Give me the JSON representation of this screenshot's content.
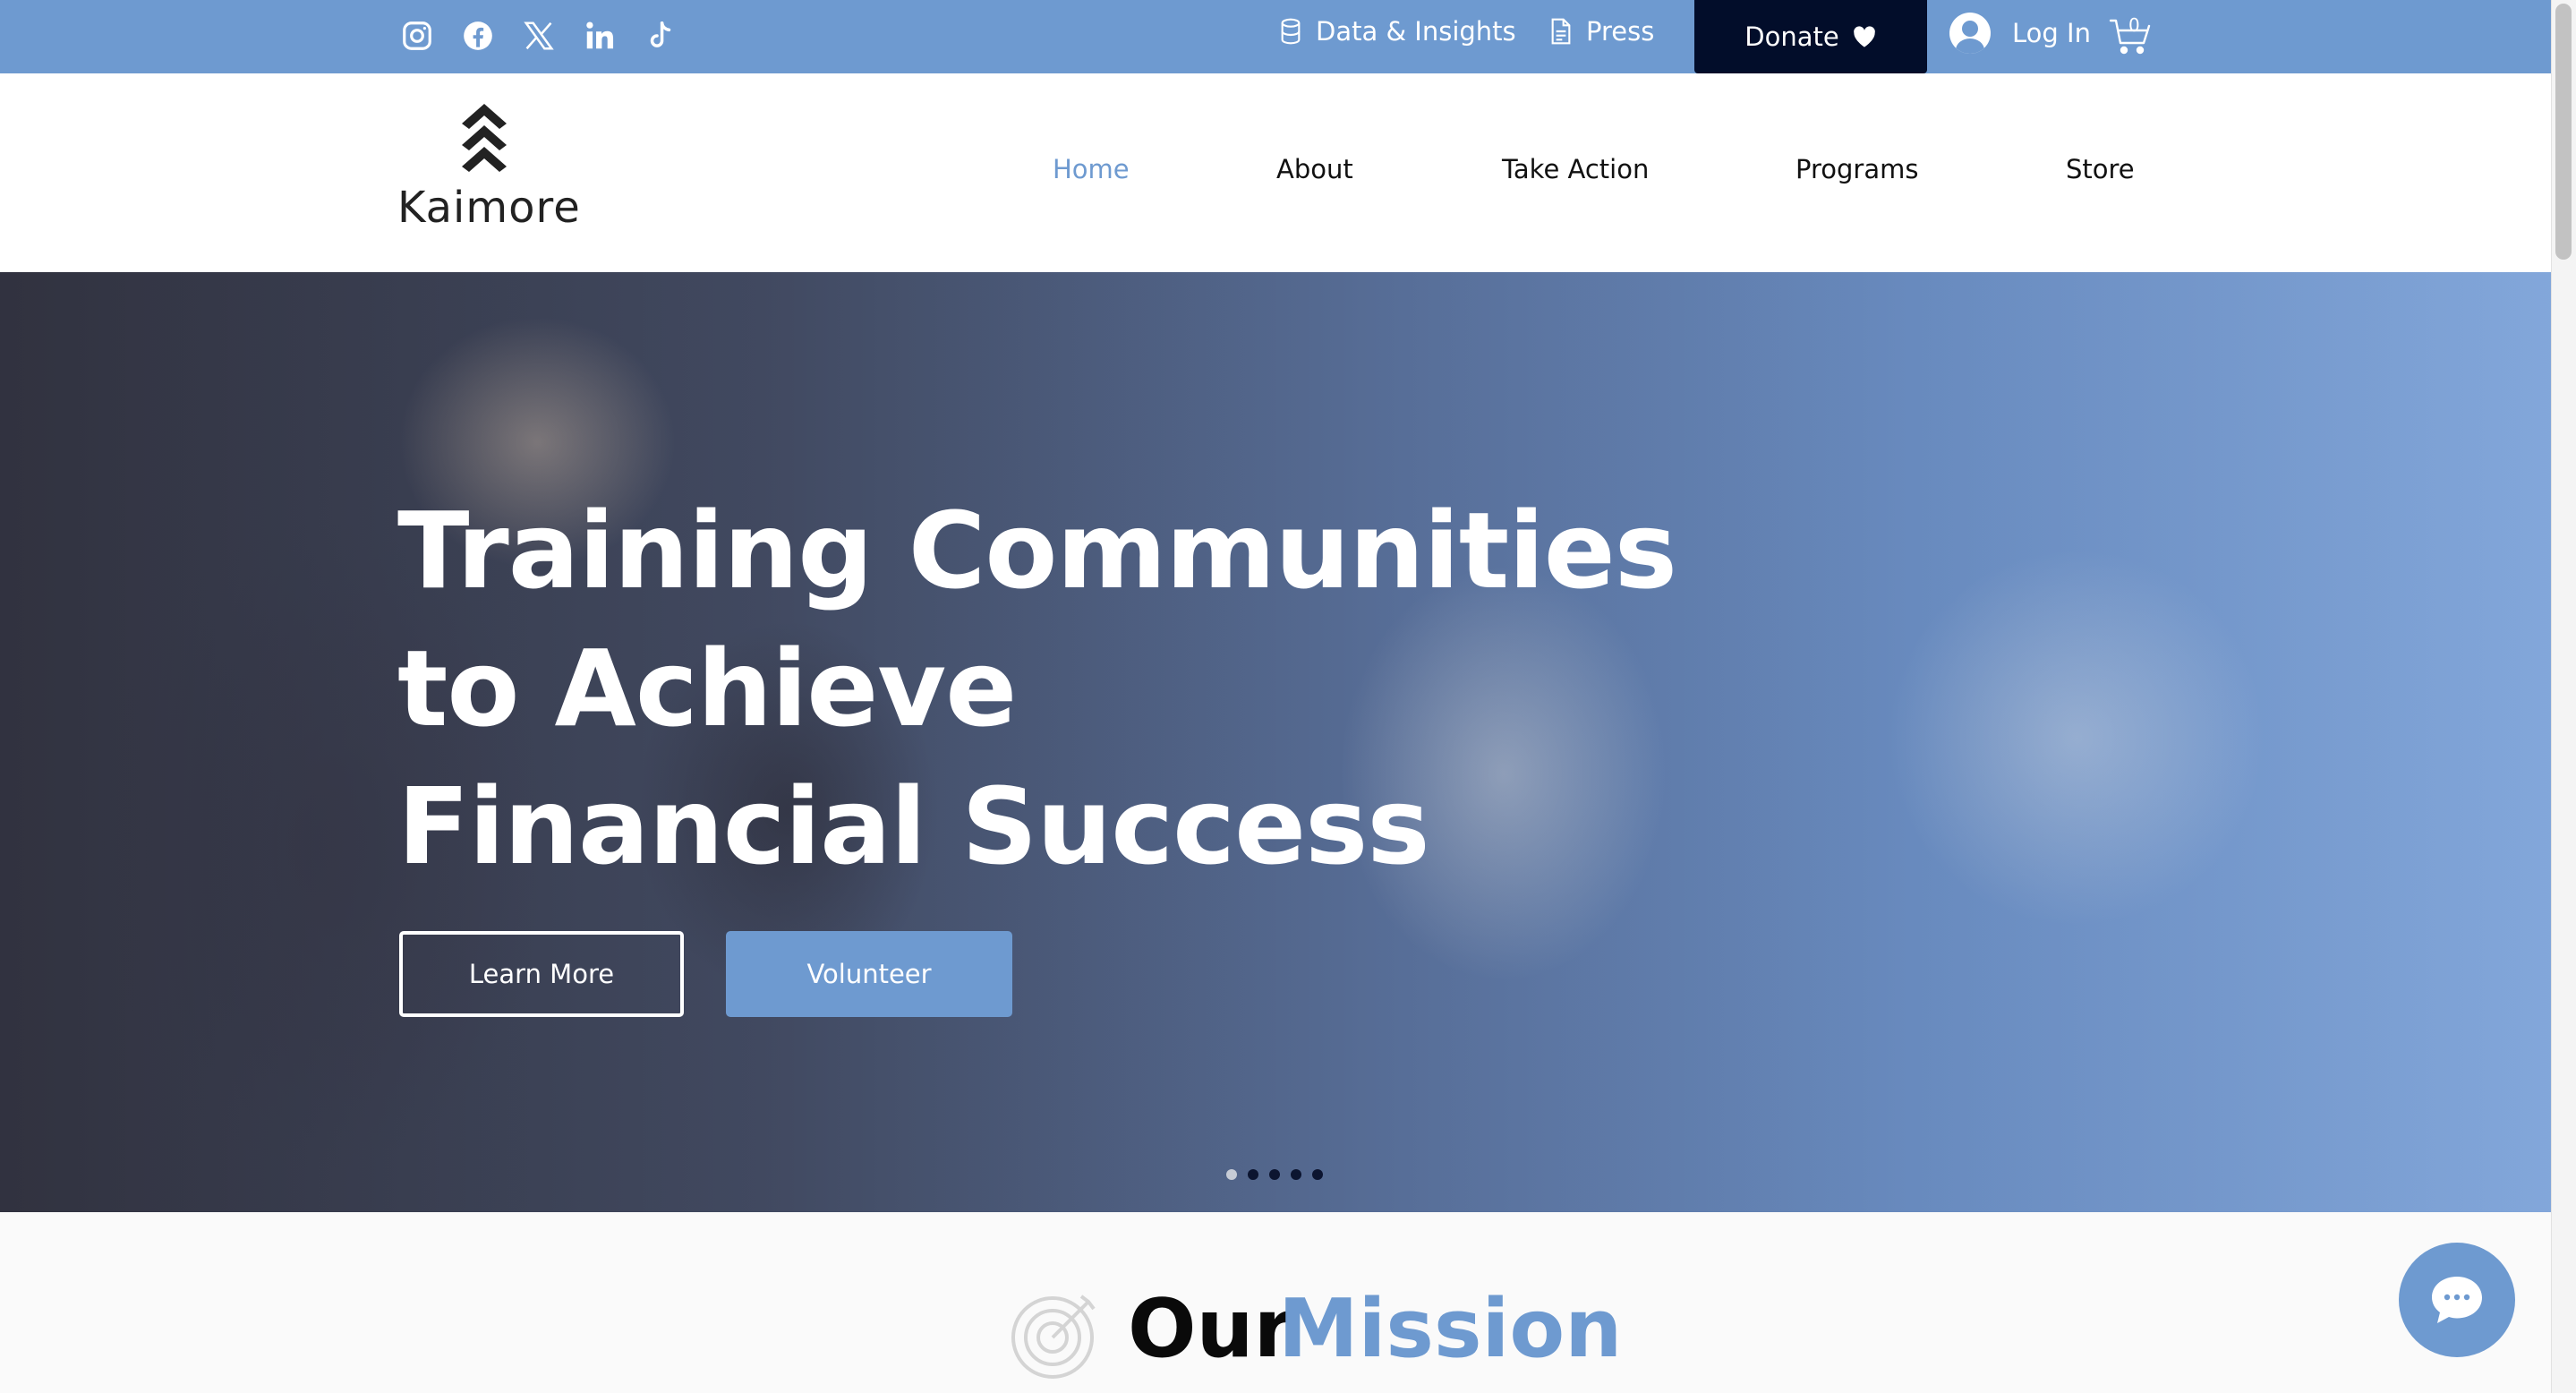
{
  "topbar": {
    "social": [
      {
        "icon": "instagram-icon"
      },
      {
        "icon": "facebook-icon"
      },
      {
        "icon": "x-twitter-icon"
      },
      {
        "icon": "linkedin-icon"
      },
      {
        "icon": "tiktok-icon"
      }
    ],
    "data_insights_label": "Data & Insights",
    "press_label": "Press",
    "donate_label": "Donate",
    "login_label": "Log In",
    "cart_count": "0"
  },
  "header": {
    "logo_text": "Kaimore",
    "nav": [
      "Home",
      "About",
      "Take Action",
      "Programs",
      "Store"
    ],
    "active_nav": "Home"
  },
  "hero": {
    "title_lines": [
      "Training Communities",
      "to Achieve",
      "Financial Success"
    ],
    "learn_more_label": "Learn More",
    "volunteer_label": "Volunteer",
    "slide_count": 5,
    "active_slide": 1
  },
  "mission": {
    "heading_first": "Our",
    "heading_second": "Mission",
    "icon": "target-icon"
  },
  "chat": {
    "icon": "chat-icon"
  },
  "colors": {
    "accent": "#6e9ad0",
    "donate_bg": "#020d2a",
    "text_dark": "#111111"
  }
}
